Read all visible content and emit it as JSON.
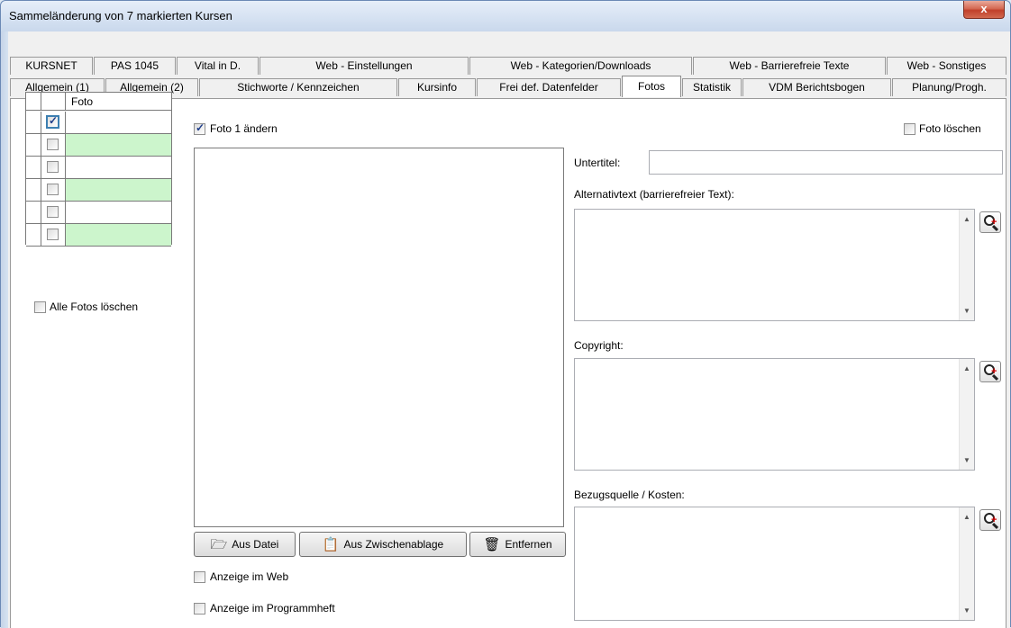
{
  "window": {
    "title": "Sammeländerung von 7 markierten Kursen",
    "close_label": "x"
  },
  "tabs_row1": [
    "KURSNET",
    "PAS 1045",
    "Vital in D.",
    "Web - Einstellungen",
    "Web - Kategorien/Downloads",
    "Web - Barrierefreie Texte",
    "Web - Sonstiges"
  ],
  "tabs_row2": [
    "Allgemein (1)",
    "Allgemein (2)",
    "Stichworte / Kennzeichen",
    "Kursinfo",
    "Frei def. Datenfelder",
    "Fotos",
    "Statistik",
    "VDM Berichtsbogen",
    "Planung/Progh."
  ],
  "active_tab": "Fotos",
  "photo_grid": {
    "header": "Foto",
    "rows": [
      {
        "checked": true,
        "color": "#ffffff"
      },
      {
        "checked": false,
        "color": "#ccf5cc"
      },
      {
        "checked": false,
        "color": "#ffffff"
      },
      {
        "checked": false,
        "color": "#ccf5cc"
      },
      {
        "checked": false,
        "color": "#ffffff"
      },
      {
        "checked": false,
        "color": "#ccf5cc"
      }
    ]
  },
  "options": {
    "alle_fotos_loeschen": "Alle Fotos löschen",
    "foto_aendern": "Foto 1 ändern",
    "foto_loeschen": "Foto löschen",
    "anzeige_web": "Anzeige im Web",
    "anzeige_programmheft": "Anzeige im Programmheft"
  },
  "buttons": {
    "aus_datei": "Aus Datei",
    "aus_zwischenablage": "Aus Zwischenablage",
    "entfernen": "Entfernen"
  },
  "fields": {
    "untertitel_label": "Untertitel:",
    "untertitel_value": "",
    "alternativtext_label": "Alternativtext (barrierefreier Text):",
    "alternativtext_value": "",
    "copyright_label": "Copyright:",
    "copyright_value": "",
    "bezugsquelle_label": "Bezugsquelle / Kosten:",
    "bezugsquelle_value": ""
  },
  "icons": {
    "folder": "folder-open-icon",
    "clipboard": "clipboard-icon",
    "trash": "trash-icon",
    "zoom": "zoom-in-icon"
  }
}
